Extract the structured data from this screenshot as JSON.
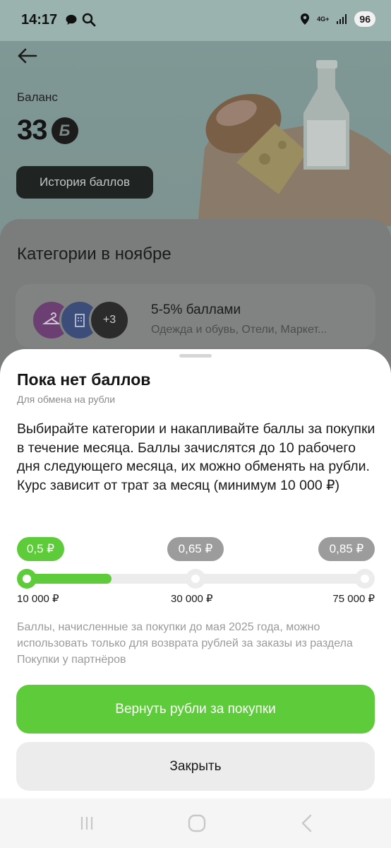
{
  "status_bar": {
    "time": "14:17",
    "left_icons": [
      "chat-bubble-icon",
      "search-icon"
    ],
    "network": "4G+",
    "battery": "96"
  },
  "header": {
    "back_icon": "arrow-left-icon",
    "balance_label": "Баланс",
    "balance_value": "33",
    "points_symbol": "Б",
    "history_button": "История баллов"
  },
  "categories": {
    "title": "Категории в ноябре",
    "item": {
      "icons": [
        "hanger-icon",
        "hotel-icon"
      ],
      "more_count": "+3",
      "title": "5-5% баллами",
      "subtitle": "Одежда и обувь, Отели, Маркет..."
    }
  },
  "sheet": {
    "title": "Пока нет баллов",
    "subtitle": "Для обмена на рубли",
    "body": "Выбирайте категории и накапливайте баллы за покупки в течение месяца. Баллы зачислятся до 10 рабочего дня следующего месяца, их можно обменять на рубли. Курс зависит от трат за месяц (минимум 10 000 ₽)",
    "rates": [
      "0,5 ₽",
      "0,65 ₽",
      "0,85 ₽"
    ],
    "thresholds": [
      "10 000 ₽",
      "30 000 ₽",
      "75 000 ₽"
    ],
    "progress_fraction": 0.25,
    "note": "Баллы, начисленные за покупки до мая 2025 года, можно использовать только для возврата рублей за заказы из раздела Покупки у партнёров",
    "primary_button": "Вернуть рубли за покупки",
    "secondary_button": "Закрыть"
  },
  "nav_bar": {
    "icons": [
      "recent-apps-icon",
      "home-icon",
      "back-icon"
    ]
  },
  "colors": {
    "accent_green": "#5ecb3b",
    "inactive_pill": "#9c9c9c",
    "track": "#ececec"
  }
}
